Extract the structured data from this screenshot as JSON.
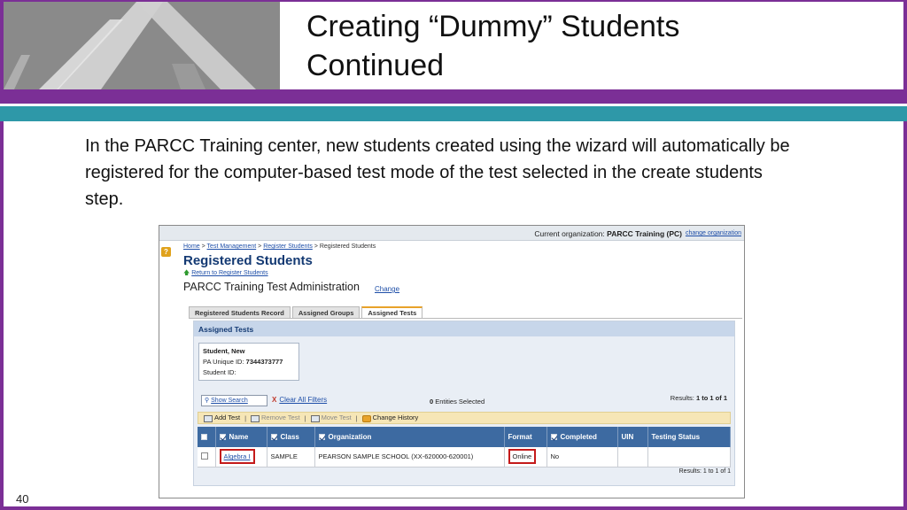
{
  "slide": {
    "title_line1": "Creating “Dummy” Students",
    "title_line2": "Continued",
    "body": "In the PARCC Training center,  new students created using the wizard will automatically be registered for the computer-based test mode of the test selected in the create students step.",
    "page_number": "40"
  },
  "app": {
    "org_prefix": "Current organization:",
    "org_name": "PARCC Training (PC)",
    "change_org": "change organization",
    "help_icon": "?",
    "breadcrumb": {
      "home": "Home",
      "sep": " > ",
      "test_management": "Test Management",
      "register_students": "Register Students",
      "current": "Registered Students"
    },
    "heading": "Registered Students",
    "return_link": "Return to Register Students",
    "admin_title": "PARCC Training Test Administration",
    "admin_change": "Change",
    "tabs": [
      {
        "label": "Registered Students Record"
      },
      {
        "label": "Assigned Groups"
      },
      {
        "label": "Assigned Tests"
      }
    ],
    "panel_title": "Assigned Tests",
    "student": {
      "name": "Student,  New",
      "unique_id_label": "PA Unique ID:",
      "unique_id": "7344373777",
      "student_id_label": "Student ID:"
    },
    "filters": {
      "show_search": "Show Search",
      "clear_all": "Clear All Filters",
      "clear_icon": "X",
      "entities_count": "0",
      "entities_label": " Entities Selected",
      "results_label": "Results: ",
      "results_value": "1 to 1 of 1"
    },
    "toolbar": {
      "add_test": "Add Test",
      "remove_test": "Remove Test",
      "move_test": "Move Test",
      "change_history": "Change History",
      "sep": "|"
    },
    "table": {
      "headers": [
        "Name",
        "Class",
        "Organization",
        "Format",
        "Completed",
        "UIN",
        "Testing Status"
      ],
      "rows": [
        {
          "name": "Algebra I",
          "class": "SAMPLE",
          "organization": "PEARSON SAMPLE SCHOOL (XX-620000-620001)",
          "format": "Online",
          "completed": "No",
          "uin": "",
          "status": ""
        }
      ]
    },
    "results_bottom": "Results: 1 to 1 of 1"
  },
  "colors": {
    "purple": "#7b2f96",
    "teal": "#2e98a8",
    "header_blue": "#3d6aa1",
    "highlight_red": "#c41a1a"
  }
}
